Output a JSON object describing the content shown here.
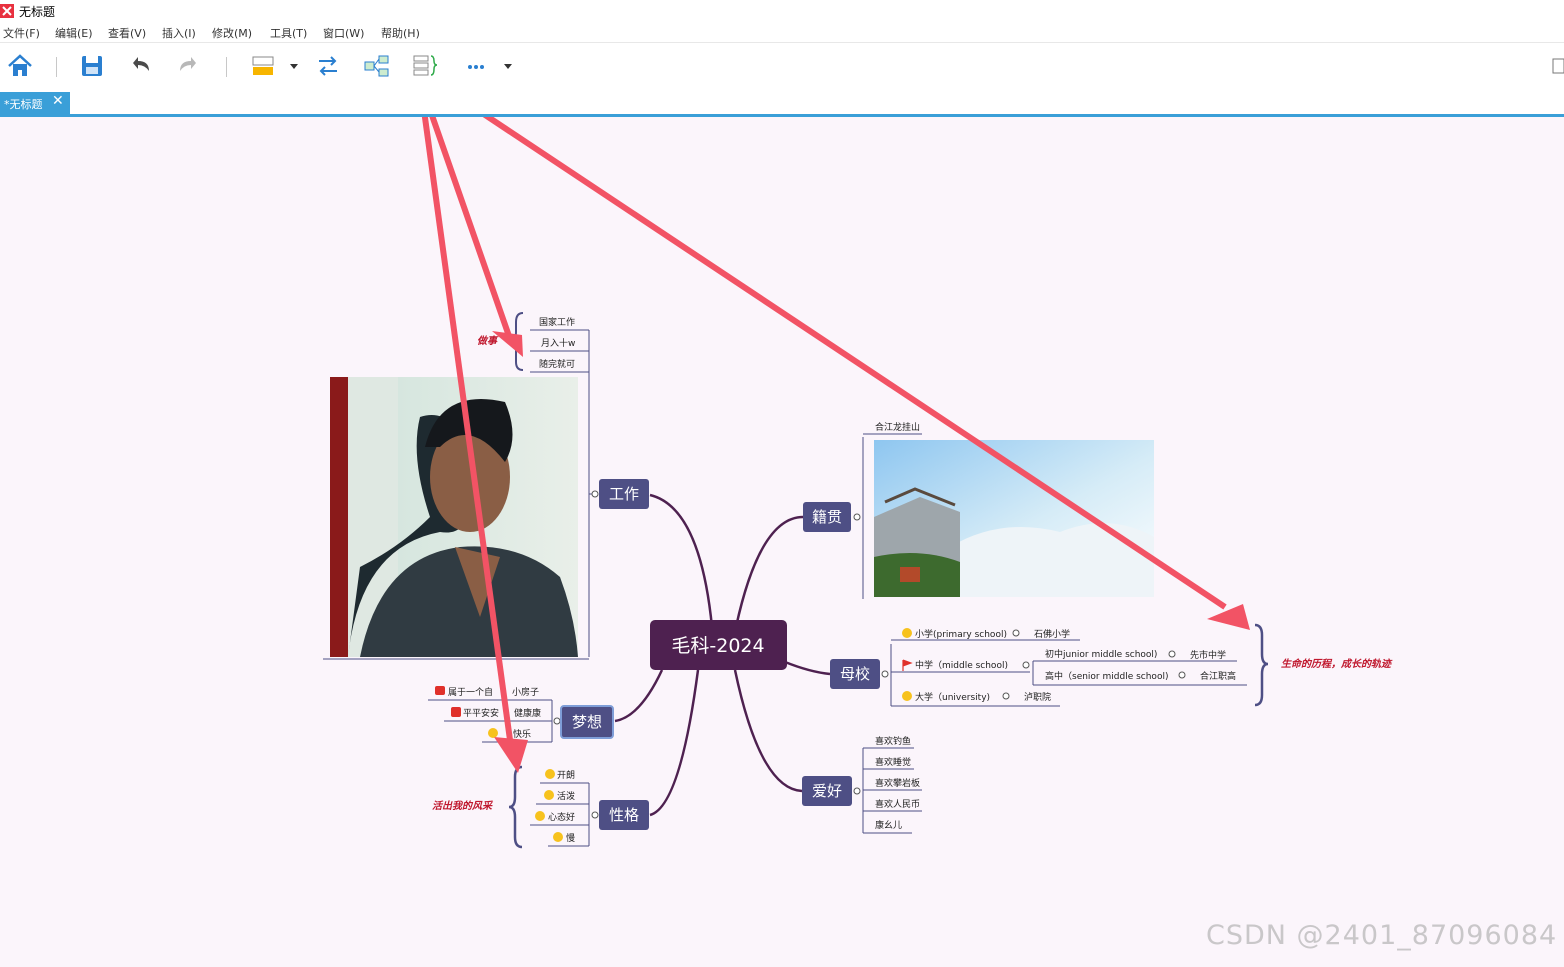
{
  "window": {
    "title": "无标题"
  },
  "menu": [
    "文件(F)",
    "编辑(E)",
    "查看(V)",
    "插入(I)",
    "修改(M)",
    "工具(T)",
    "窗口(W)",
    "帮助(H)"
  ],
  "tab": {
    "label": "*无标题",
    "close": "✕"
  },
  "toolbar": {
    "icons": [
      "home-icon",
      "save-icon",
      "undo-icon",
      "redo-icon",
      "topic-style-icon",
      "relationship-icon",
      "structure-icon",
      "summary-icon",
      "more-icon",
      "dropdown-icon"
    ]
  },
  "colors": {
    "accent": "#3a9fd8",
    "central": "#4e2150",
    "branch": "#4e4f85",
    "arrow": "#f25365",
    "summary_text": "#c0182e",
    "canvas": "#fbf5fb"
  },
  "mindmap": {
    "central": "毛科-2024",
    "work": {
      "label": "工作",
      "items": [
        "国家工作",
        "月入十w",
        "随完就可"
      ],
      "summary": "做事"
    },
    "dream": {
      "label": "梦想",
      "items": [
        "属于一个自",
        "小房子",
        "平平安安",
        "健康康",
        "快乐"
      ]
    },
    "personality": {
      "label": "性格",
      "items": [
        "开朗",
        "活泼",
        "心态好",
        "慢"
      ],
      "summary": "活出我的风采"
    },
    "origin": {
      "label": "籍贯",
      "place": "合江龙挂山"
    },
    "school": {
      "label": "母校",
      "primary": {
        "label": "小学(primary school)",
        "value": "石佛小学"
      },
      "middle": {
        "label": "中学（middle  school)",
        "junior": {
          "label": "初中junior middle school)",
          "value": "先市中学"
        },
        "senior": {
          "label": "高中（senior middle school)",
          "value": "合江职高"
        }
      },
      "university": {
        "label": "大学（university)",
        "value": "泸职院"
      },
      "summary": "生命的历程，成长的轨迹"
    },
    "hobby": {
      "label": "爱好",
      "items": [
        "喜欢钓鱼",
        "喜欢睡觉",
        "喜欢攀岩板",
        "喜欢人民币",
        "康幺儿"
      ]
    }
  },
  "watermark": "CSDN @2401_87096084"
}
